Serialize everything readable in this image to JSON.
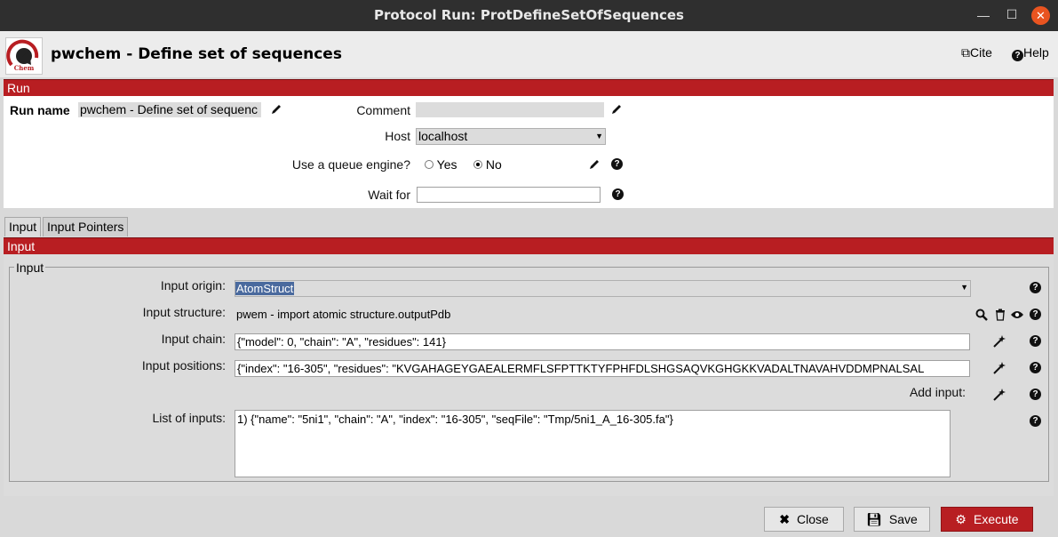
{
  "window": {
    "title": "Protocol Run: ProtDefineSetOfSequences"
  },
  "header": {
    "title": "pwchem - Define set of sequences",
    "logo_text": "Chem",
    "cite_label": "Cite",
    "help_label": "Help"
  },
  "run_section": {
    "title": "Run",
    "run_name_label": "Run name",
    "run_name_value": "pwchem - Define set of sequenc",
    "comment_label": "Comment",
    "comment_value": "",
    "host_label": "Host",
    "host_value": "localhost",
    "queue_label": "Use a queue engine?",
    "queue_options": [
      "Yes",
      "No"
    ],
    "queue_selected": "No",
    "wait_label": "Wait for",
    "wait_value": ""
  },
  "tabs": [
    {
      "label": "Input",
      "active": true
    },
    {
      "label": "Input Pointers",
      "active": false
    }
  ],
  "input_section": {
    "title": "Input",
    "group_label": "Input",
    "origin_label": "Input origin:",
    "origin_value": "AtomStruct",
    "structure_label": "Input structure:",
    "structure_value": "pwem - import atomic structure.outputPdb",
    "chain_label": "Input chain:",
    "chain_value": "{\"model\": 0, \"chain\": \"A\", \"residues\": 141}",
    "positions_label": "Input positions:",
    "positions_value": "{\"index\": \"16-305\", \"residues\": \"KVGAHAGEYGAEALERMFLSFPTTKTYFPHFDLSHGSAQVKGHGKKVADALTNAVAHVDDMPNALSAL",
    "add_input_label": "Add input:",
    "list_label": "List of inputs:",
    "list_items": [
      "1) {\"name\": \"5ni1\", \"chain\": \"A\", \"index\": \"16-305\", \"seqFile\": \"Tmp/5ni1_A_16-305.fa\"}"
    ]
  },
  "footer": {
    "close_label": "Close",
    "save_label": "Save",
    "execute_label": "Execute"
  },
  "colors": {
    "accent_red": "#b81e22",
    "titlebar": "#2f2f2f",
    "close_orange": "#e95420"
  }
}
